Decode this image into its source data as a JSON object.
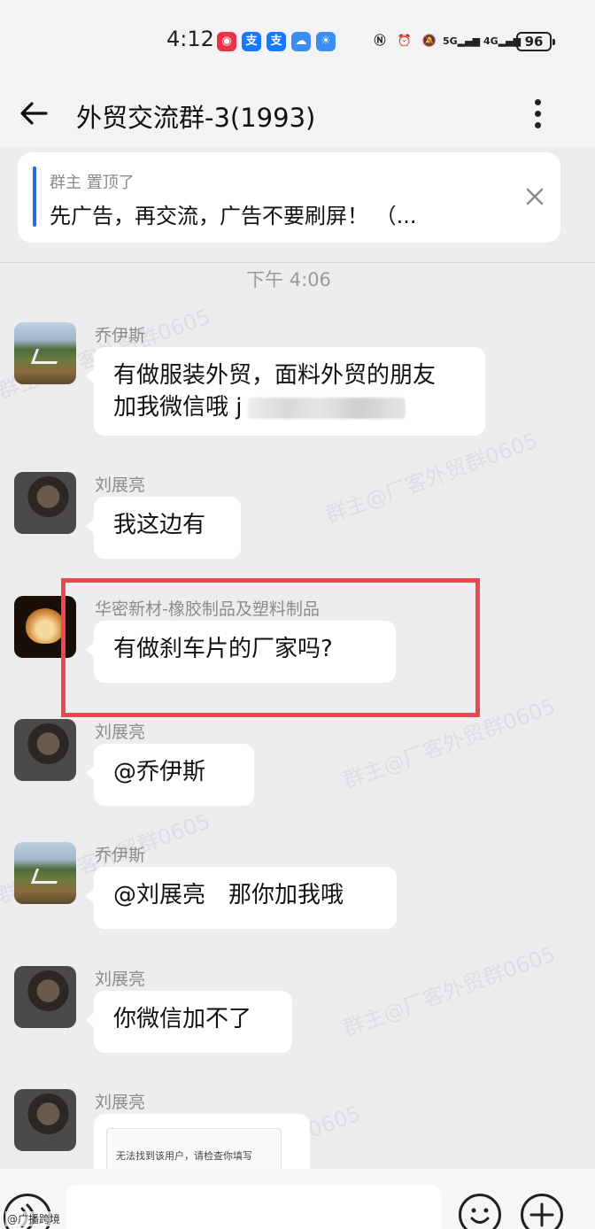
{
  "status_bar": {
    "time": "4:12",
    "app_icons": [
      {
        "name": "huawei-video-icon",
        "glyph": "◉",
        "color": "#e8334a"
      },
      {
        "name": "alipay-icon",
        "glyph": "支",
        "color": "#1677ff"
      },
      {
        "name": "alipay-icon-2",
        "glyph": "支",
        "color": "#1677ff"
      },
      {
        "name": "cloud-icon",
        "glyph": "☁",
        "color": "#3a8ef0"
      },
      {
        "name": "weather-icon",
        "glyph": "☀",
        "color": "#3a8ef0"
      }
    ],
    "signal_5g": "5G",
    "signal_4g": "4G",
    "battery": "96"
  },
  "header": {
    "title": "外贸交流群-3(1993)"
  },
  "pinned": {
    "meta": "群主 置顶了",
    "text": "先广告，再交流，广告不要刷屏！ （..."
  },
  "timestamp": "下午 4:06",
  "messages": [
    {
      "sender": "乔伊斯",
      "text": "有做服装外贸，面料外贸的朋友 加我微信哦 j",
      "avatar": "landscape-avatar"
    },
    {
      "sender": "刘展亮",
      "text": "我这边有",
      "avatar": "man-avatar"
    },
    {
      "sender": "华密新材-橡胶制品及塑料制品",
      "text": "有做刹车片的厂家吗?",
      "avatar": "heart-avatar"
    },
    {
      "sender": "刘展亮",
      "text": "@乔伊斯",
      "avatar": "man-avatar"
    },
    {
      "sender": "乔伊斯",
      "text": "@刘展亮　那你加我哦",
      "avatar": "landscape-avatar"
    },
    {
      "sender": "刘展亮",
      "text": "你微信加不了",
      "avatar": "man-avatar"
    },
    {
      "sender": "刘展亮",
      "card_text": "无法找到该用户，请检查你填写",
      "avatar": "man-avatar"
    }
  ],
  "watermark": "群主@厂客外贸群0605",
  "corner_tag": "@广播跨境",
  "colors": {
    "highlight": "#ea4a4f",
    "pinned_accent": "#2d6bdc"
  }
}
